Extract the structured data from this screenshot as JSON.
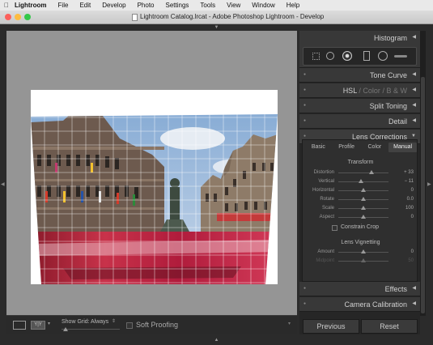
{
  "menubar": {
    "apple": "",
    "app_name": "Lightroom",
    "items": [
      "File",
      "Edit",
      "Develop",
      "Photo",
      "Settings",
      "Tools",
      "View",
      "Window",
      "Help"
    ]
  },
  "window": {
    "title": "Lightroom Catalog.lrcat - Adobe Photoshop Lightroom - Develop",
    "traffic_colors": [
      "#fc605c",
      "#fdbc40",
      "#34c84a"
    ]
  },
  "toolbar": {
    "show_grid_label": "Show Grid:",
    "show_grid_value": "Always",
    "soft_proofing": "Soft Proofing"
  },
  "panels": {
    "histogram": "Histogram",
    "tone_curve": "Tone Curve",
    "hsl": "HSL",
    "sep1": "/",
    "color": "Color",
    "sep2": "/",
    "bw": "B & W",
    "split_toning": "Split Toning",
    "detail": "Detail",
    "lens_corrections": "Lens Corrections",
    "effects": "Effects",
    "camera_calibration": "Camera Calibration"
  },
  "lens": {
    "tabs": [
      "Basic",
      "Profile",
      "Color",
      "Manual"
    ],
    "active_tab": "Manual",
    "transform_title": "Transform",
    "sliders": [
      {
        "label": "Distortion",
        "value": "+ 33",
        "position": 0.66
      },
      {
        "label": "Vertical",
        "value": "− 11",
        "position": 0.445
      },
      {
        "label": "Horizontal",
        "value": "0",
        "position": 0.5
      },
      {
        "label": "Rotate",
        "value": "0.0",
        "position": 0.5
      },
      {
        "label": "Scale",
        "value": "100",
        "position": 0.5
      },
      {
        "label": "Aspect",
        "value": "0",
        "position": 0.5
      }
    ],
    "constrain_crop": "Constrain Crop",
    "vignetting_title": "Lens Vignetting",
    "vignetting": [
      {
        "label": "Amount",
        "value": "0",
        "position": 0.5
      },
      {
        "label": "Midpoint",
        "value": "50",
        "position": 0.5,
        "dim": true
      }
    ]
  },
  "buttons": {
    "previous": "Previous",
    "reset": "Reset"
  }
}
